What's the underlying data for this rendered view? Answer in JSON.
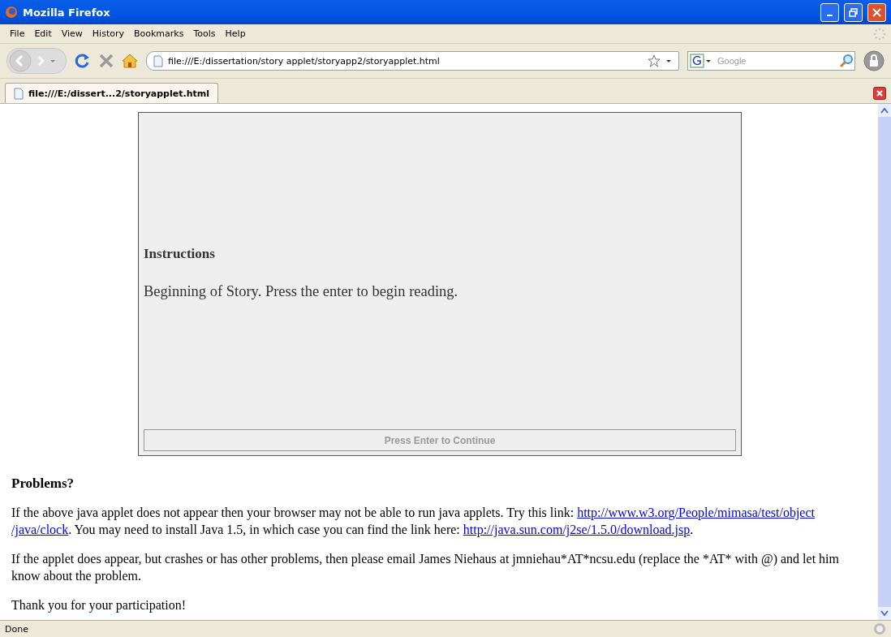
{
  "window": {
    "title": "Mozilla Firefox"
  },
  "menu": [
    {
      "label": "File"
    },
    {
      "label": "Edit"
    },
    {
      "label": "View"
    },
    {
      "label": "History"
    },
    {
      "label": "Bookmarks"
    },
    {
      "label": "Tools"
    },
    {
      "label": "Help"
    }
  ],
  "navigation": {
    "url": "file:///E:/dissertation/story applet/storyapp2/storyapplet.html",
    "search": {
      "placeholder": "Google"
    }
  },
  "tabs": [
    {
      "label": "file:///E:/dissert...2/storyapplet.html",
      "selected": true
    }
  ],
  "applet": {
    "heading": "Instructions",
    "message": "Beginning of Story. Press the enter to begin reading.",
    "button": {
      "label": "Press Enter to Continue",
      "disabled": true
    }
  },
  "problems": {
    "heading": "Problems?",
    "paragraphs": [
      [
        {
          "kind": "text",
          "text": "If the above java applet does not appear then your browser may not be able to run java applets. Try this link: "
        },
        {
          "kind": "link",
          "text": "http://www.w3.org/People/mimasa/test/object"
        },
        {
          "kind": "break"
        },
        {
          "kind": "link",
          "text": "/java/clock"
        },
        {
          "kind": "text",
          "text": ". You may need to install Java 1.5, in which case you can find the link here: "
        },
        {
          "kind": "link",
          "text": "http://java.sun.com/j2se/1.5.0/download.jsp"
        },
        {
          "kind": "text",
          "text": "."
        }
      ],
      [
        {
          "kind": "text",
          "text": "If the applet does appear, but crashes or has other problems, then please email James Niehaus at jmniehau*AT*ncsu.edu (replace the *AT* with @) and let him know about the problem."
        }
      ],
      [
        {
          "kind": "text",
          "text": "Thank you for your participation!"
        }
      ]
    ]
  },
  "status_bar": {
    "text": "Done"
  }
}
